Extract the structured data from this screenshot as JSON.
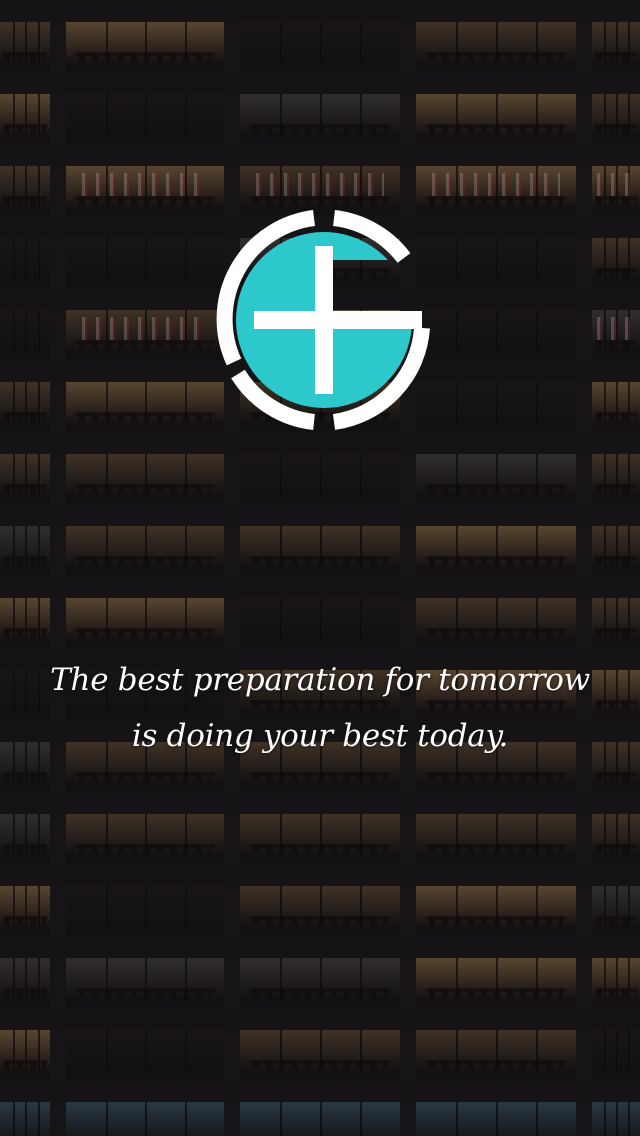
{
  "screen": {
    "background_image": "night-office-building-icon",
    "logo": {
      "icon": "circle-plus-logo-icon",
      "accent_color": "#2cc8cc",
      "ring_color": "#ffffff"
    },
    "quote": {
      "line1": "The best preparation for tomorrow",
      "line2": "is doing your best today."
    }
  }
}
